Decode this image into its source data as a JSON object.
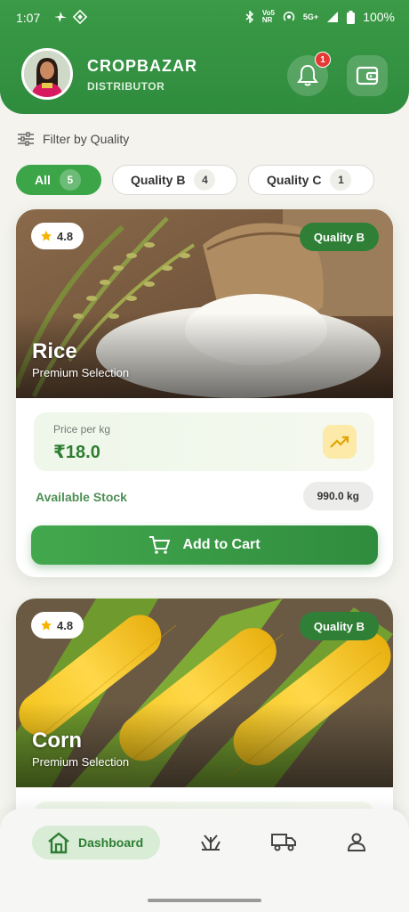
{
  "status": {
    "time": "1:07",
    "battery": "100%",
    "net_top": "Vo5",
    "net_bottom": "NR",
    "net5g": "5G+"
  },
  "header": {
    "title": "CROPBAZAR",
    "subtitle": "DISTRIBUTOR",
    "notification_count": "1"
  },
  "filter": {
    "label": "Filter by Quality",
    "chips": [
      {
        "label": "All",
        "count": "5"
      },
      {
        "label": "Quality B",
        "count": "4"
      },
      {
        "label": "Quality C",
        "count": "1"
      }
    ]
  },
  "products": [
    {
      "name": "Rice",
      "subtitle": "Premium Selection",
      "rating": "4.8",
      "quality": "Quality B",
      "price_label": "Price per kg",
      "price": "₹18.0",
      "stock_label": "Available Stock",
      "stock": "990.0 kg",
      "cart_label": "Add to Cart"
    },
    {
      "name": "Corn",
      "subtitle": "Premium Selection",
      "rating": "4.8",
      "quality": "Quality B"
    }
  ],
  "nav": {
    "dashboard": "Dashboard"
  },
  "colors": {
    "primary": "#2f8c3e",
    "accent": "#3ba548",
    "badge": "#e53935"
  }
}
